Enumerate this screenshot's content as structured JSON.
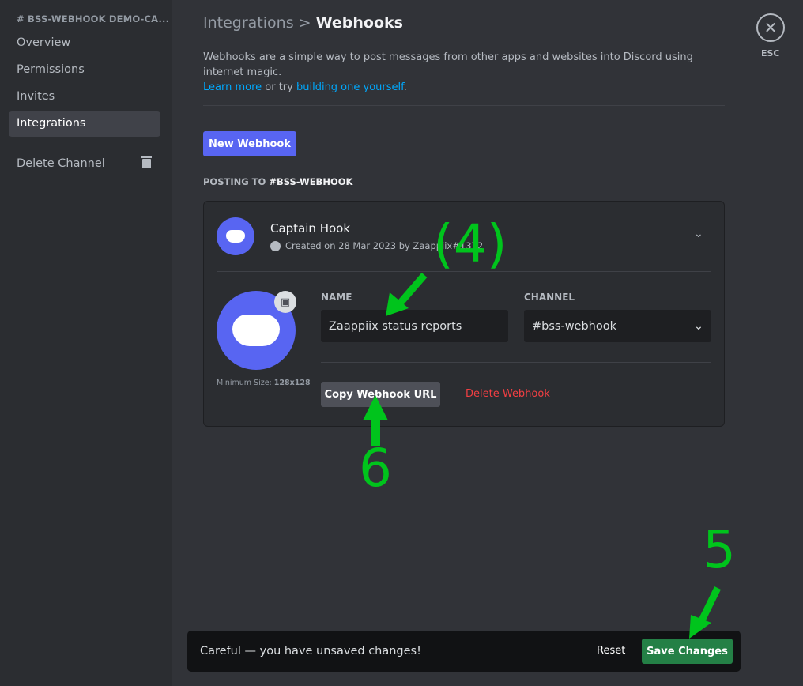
{
  "sidebar": {
    "header": "# BSS-WEBHOOK DEMO-CA...",
    "items": [
      "Overview",
      "Permissions",
      "Invites",
      "Integrations"
    ],
    "delete": "Delete Channel"
  },
  "header": {
    "crumb": "Integrations",
    "sep": ">",
    "title": "Webhooks",
    "description": "Webhooks are a simple way to post messages from other apps and websites into Discord using internet magic.",
    "learn_more": "Learn more",
    "or_try": " or try ",
    "build": "building one yourself",
    "dot": "."
  },
  "close": {
    "label": "ESC"
  },
  "new_webhook": "New Webhook",
  "posting_to": {
    "prefix": "POSTING TO ",
    "channel": "#BSS-WEBHOOK"
  },
  "webhook": {
    "name": "Captain Hook",
    "created": "Created on 28 Mar 2023 by Zaappiix#1372",
    "min_size_label": "Minimum Size: ",
    "min_size": "128x128",
    "name_label": "NAME",
    "name_value": "Zaappiix status reports",
    "channel_label": "CHANNEL",
    "channel_value": "#bss-webhook",
    "copy_url": "Copy Webhook URL",
    "delete": "Delete Webhook"
  },
  "unsaved": {
    "message": "Careful — you have unsaved changes!",
    "reset": "Reset",
    "save": "Save Changes"
  },
  "annotations": {
    "a4": "(4)",
    "a5": "5",
    "a6": "6"
  }
}
